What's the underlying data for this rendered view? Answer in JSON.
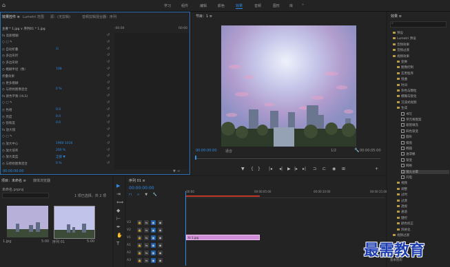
{
  "topbar": {
    "workspaces": [
      "学习",
      "组件",
      "编辑",
      "颜色",
      "效果",
      "音频",
      "图形",
      "库"
    ],
    "active_index": 4
  },
  "effect_controls": {
    "tabs": [
      "效果控件 ≡",
      "Lumetri 范围",
      "源：(无剪辑)",
      "音频剪辑混合器：序列"
    ],
    "header_left": "主要 * 1.jpg ∨  序列01 * 1.jpg",
    "time_start": ":00:00",
    "time_end": "00:00",
    "rows": [
      {
        "label": "fx 高斯模糊",
        "value": ""
      },
      {
        "label": "○ ▢ ✎",
        "value": ""
      },
      {
        "label": "◷ 自动折叠",
        "value": "☑"
      },
      {
        "label": "◷ 多边形折",
        "value": ""
      },
      {
        "label": "◷ 多边形射",
        "value": ""
      },
      {
        "label": "◷ 模糊半径（像）",
        "value": "108"
      },
      {
        "label": "  折叠效果",
        "value": ""
      },
      {
        "label": "◷ 更多模糊",
        "value": ""
      },
      {
        "label": "◷ 与原始图像混合",
        "value": "0 %"
      },
      {
        "label": "fx 颜色平衡 (HLS)",
        "value": ""
      },
      {
        "label": "○ ▢ ✎",
        "value": ""
      },
      {
        "label": "◷ 色相",
        "value": "0.0"
      },
      {
        "label": "◷ 亮度",
        "value": "0.0"
      },
      {
        "label": "◷ 饱和度",
        "value": "0.0"
      },
      {
        "label": "fx 放大镜",
        "value": ""
      },
      {
        "label": "○ ▢ ✎",
        "value": ""
      },
      {
        "label": "◷ 放大中心",
        "value": "1960   1016"
      },
      {
        "label": "◷ 放大倍率",
        "value": "200 %"
      },
      {
        "label": "◷ 放大类型",
        "value": "全部  ▼"
      },
      {
        "label": "◷ 与原始图像混合",
        "value": "0 %"
      }
    ],
    "bottom_time": "00:00:00:00"
  },
  "program_monitor": {
    "title": "节目：1 ≡",
    "timecode_left": "00:00:00:00",
    "fit_label": "适合",
    "quality_label": "1/2",
    "timecode_right": "00:00:05:00"
  },
  "effects_panel": {
    "title": "效果 ≡",
    "items": [
      {
        "label": "预设",
        "type": "folder",
        "indent": 0
      },
      {
        "label": "Lumetri 预设",
        "type": "folder",
        "indent": 0
      },
      {
        "label": "音频效果",
        "type": "folder",
        "indent": 0
      },
      {
        "label": "音频过渡",
        "type": "folder",
        "indent": 0
      },
      {
        "label": "视频效果",
        "type": "folder",
        "indent": 0
      },
      {
        "label": "变换",
        "type": "folder",
        "indent": 1
      },
      {
        "label": "图像控制",
        "type": "folder",
        "indent": 1
      },
      {
        "label": "实用程序",
        "type": "folder",
        "indent": 1
      },
      {
        "label": "扭曲",
        "type": "folder",
        "indent": 1
      },
      {
        "label": "时间",
        "type": "folder",
        "indent": 1
      },
      {
        "label": "杂色与颗粒",
        "type": "folder",
        "indent": 1
      },
      {
        "label": "模糊与锐化",
        "type": "folder",
        "indent": 1
      },
      {
        "label": "沉浸式视频",
        "type": "folder",
        "indent": 1
      },
      {
        "label": "生成",
        "type": "folder",
        "indent": 1
      },
      {
        "label": "书写",
        "type": "item",
        "indent": 2
      },
      {
        "label": "单元格图案",
        "type": "item",
        "indent": 2
      },
      {
        "label": "吸管填充",
        "type": "item",
        "indent": 2
      },
      {
        "label": "四色渐变",
        "type": "item",
        "indent": 2
      },
      {
        "label": "圆形",
        "type": "item",
        "indent": 2
      },
      {
        "label": "棋盘",
        "type": "item",
        "indent": 2
      },
      {
        "label": "椭圆",
        "type": "item",
        "indent": 2
      },
      {
        "label": "油漆桶",
        "type": "item",
        "indent": 2
      },
      {
        "label": "渐变",
        "type": "item",
        "indent": 2
      },
      {
        "label": "网格",
        "type": "item",
        "indent": 2
      },
      {
        "label": "镜头光晕",
        "type": "item",
        "indent": 2,
        "selected": true
      },
      {
        "label": "闪电",
        "type": "item",
        "indent": 2
      },
      {
        "label": "视频",
        "type": "folder",
        "indent": 1
      },
      {
        "label": "调整",
        "type": "folder",
        "indent": 1
      },
      {
        "label": "过时",
        "type": "folder",
        "indent": 1
      },
      {
        "label": "过渡",
        "type": "folder",
        "indent": 1
      },
      {
        "label": "透视",
        "type": "folder",
        "indent": 1
      },
      {
        "label": "通道",
        "type": "folder",
        "indent": 1
      },
      {
        "label": "键控",
        "type": "folder",
        "indent": 1
      },
      {
        "label": "颜色校正",
        "type": "folder",
        "indent": 1
      },
      {
        "label": "风格化",
        "type": "folder",
        "indent": 1
      },
      {
        "label": "视频过渡",
        "type": "folder",
        "indent": 0
      }
    ],
    "footer": "基本图形"
  },
  "project_panel": {
    "tabs": [
      "项目：未命名 ≡",
      "媒体浏览器"
    ],
    "name": "未命名.prproj",
    "count": "1 项已选择，共 2 项",
    "clips": [
      {
        "name": "1.jpg",
        "duration": "5:00"
      },
      {
        "name": "序列 01",
        "duration": "5:00"
      }
    ]
  },
  "timeline": {
    "title": "序列 01 ≡",
    "timecode": "00:00:00:00",
    "ruler": [
      ":00:00",
      "00:00:05:00",
      "00:00:10:00",
      "00:00:15:00"
    ],
    "video_tracks": [
      "V3",
      "V2",
      "V1"
    ],
    "audio_tracks": [
      "A1",
      "A2",
      "A3"
    ],
    "clip_label": "fx 1.jpg"
  },
  "watermark": "最需教育"
}
